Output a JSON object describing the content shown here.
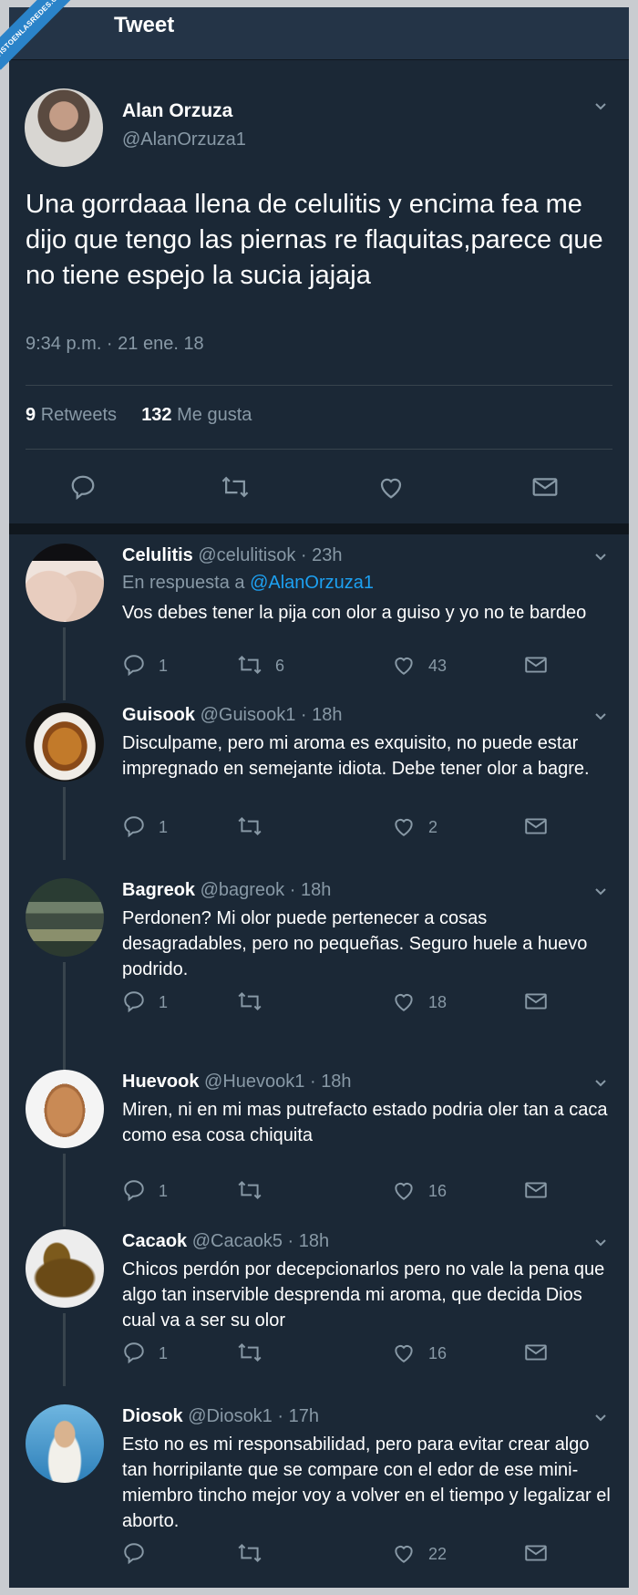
{
  "watermark": "VISTOENLASREDES.COM",
  "header": {
    "title": "Tweet"
  },
  "main_tweet": {
    "name": "Alan Orzuza",
    "handle": "@AlanOrzuza1",
    "text": "Una gorrdaaa llena de celulitis y encima fea me dijo que tengo las piernas re flaquitas,parece que no tiene espejo la sucia jajaja",
    "time": "9:34 p.m. · 21 ene. 18",
    "retweets_count": "9",
    "retweets_label": "Retweets",
    "likes_count": "132",
    "likes_label": "Me gusta"
  },
  "replies": [
    {
      "name": "Celulitis",
      "handle": "@celulitisok",
      "time": "23h",
      "in_reply_prefix": "En respuesta a",
      "in_reply_to": "@AlanOrzuza1",
      "text": "Vos debes tener la pija con olor a guiso y yo no te bardeo",
      "replies": "1",
      "retweets": "6",
      "likes": "43",
      "avatar": "legs-image"
    },
    {
      "name": "Guisook",
      "handle": "@Guisook1",
      "time": "18h",
      "text": "Disculpame, pero mi aroma es exquisito,  no puede estar impregnado en semejante idiota. Debe tener olor a bagre.",
      "replies": "1",
      "retweets": "",
      "likes": "2",
      "avatar": "stew-image"
    },
    {
      "name": "Bagreok",
      "handle": "@bagreok",
      "time": "18h",
      "text": "Perdonen? Mi olor puede pertenecer a cosas desagradables, pero no pequeñas. Seguro huele a huevo podrido.",
      "replies": "1",
      "retweets": "",
      "likes": "18",
      "avatar": "catfish-image"
    },
    {
      "name": "Huevook",
      "handle": "@Huevook1",
      "time": "18h",
      "text": "Miren, ni en mi mas putrefacto estado podria oler tan a caca como esa cosa chiquita",
      "replies": "1",
      "retweets": "",
      "likes": "16",
      "avatar": "egg-image"
    },
    {
      "name": "Cacaok",
      "handle": "@Cacaok5",
      "time": "18h",
      "text": "Chicos perdón por decepcionarlos pero no vale la pena que algo tan inservible desprenda mi aroma, que decida Dios cual va a ser su olor",
      "replies": "1",
      "retweets": "",
      "likes": "16",
      "avatar": "poop-image"
    },
    {
      "name": "Diosok",
      "handle": "@Diosok1",
      "time": "17h",
      "text": "Esto no es mi responsabilidad, pero para evitar crear algo tan horripilante que se compare con el edor de ese mini-miembro tincho mejor voy a volver en el tiempo y legalizar el aborto.",
      "replies": "",
      "retweets": "",
      "likes": "22",
      "avatar": "jesus-image"
    }
  ],
  "colors": {
    "background": "#1b2836",
    "header": "#243447",
    "text": "#ffffff",
    "secondary": "#8899a6",
    "link": "#1da1f2",
    "separator": "#38444d"
  }
}
